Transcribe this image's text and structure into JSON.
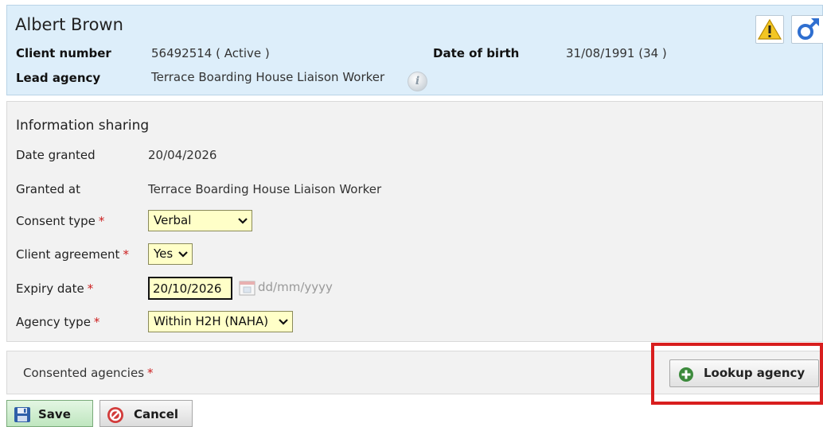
{
  "client": {
    "name": "Albert Brown",
    "client_number_label": "Client number",
    "client_number_value": "56492514 ( Active )",
    "dob_label": "Date of birth",
    "dob_value": "31/08/1991 (34 )",
    "lead_agency_label": "Lead agency",
    "lead_agency_value": "Terrace Boarding House Liaison Worker",
    "icons": [
      "warning-icon",
      "male-icon",
      "info-icon"
    ]
  },
  "info_sharing": {
    "title": "Information sharing",
    "date_granted_label": "Date granted",
    "date_granted_value": "20/04/2026",
    "granted_at_label": "Granted at",
    "granted_at_value": "Terrace Boarding House Liaison Worker",
    "consent_type_label": "Consent type",
    "consent_type_value": "Verbal",
    "client_agreement_label": "Client agreement",
    "client_agreement_value": "Yes",
    "expiry_date_label": "Expiry date",
    "expiry_date_value": "20/10/2026",
    "expiry_date_hint": "dd/mm/yyyy",
    "agency_type_label": "Agency type",
    "agency_type_value": "Within H2H (NAHA)",
    "required_marker": "*"
  },
  "consented_agencies": {
    "label": "Consented agencies",
    "lookup_label": "Lookup agency"
  },
  "actions": {
    "save_label": "Save",
    "cancel_label": "Cancel"
  },
  "colors": {
    "header_bg": "#ddeefa",
    "panel_bg": "#f2f2f2",
    "input_bg": "#ffffc8",
    "required": "#cc1f1f",
    "highlight": "#d81e1e",
    "save_green": "#bfe6bf"
  }
}
